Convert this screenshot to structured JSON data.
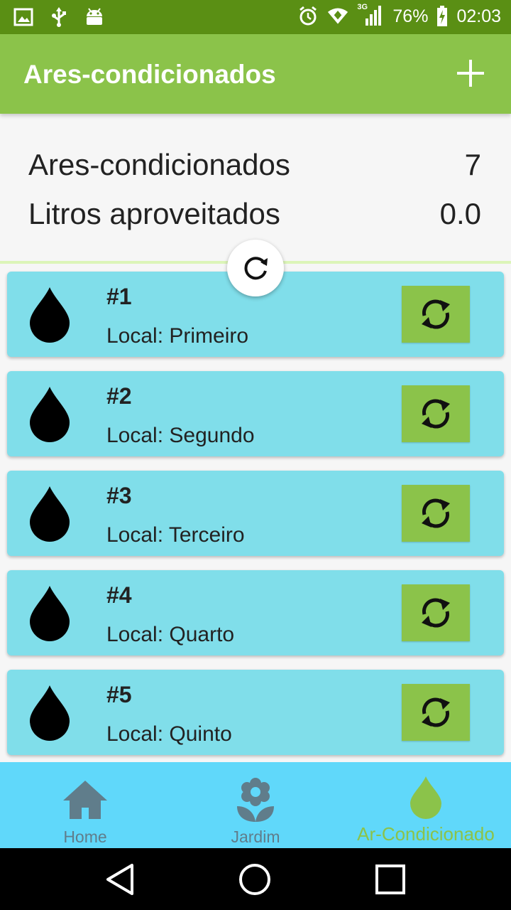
{
  "status_bar": {
    "left_icons": [
      "image-icon",
      "usb-icon",
      "android-icon"
    ],
    "network_label": "3G",
    "battery_percent": "76%",
    "time": "02:03"
  },
  "app_bar": {
    "title": "Ares-condicionados",
    "add_icon": "plus-icon"
  },
  "summary": {
    "count_label": "Ares-condicionados",
    "count_value": "7",
    "liters_label": "Litros aproveitados",
    "liters_value": "0.0"
  },
  "cards": [
    {
      "number": "#1",
      "location": "Local: Primeiro"
    },
    {
      "number": "#2",
      "location": "Local: Segundo"
    },
    {
      "number": "#3",
      "location": "Local: Terceiro"
    },
    {
      "number": "#4",
      "location": "Local: Quarto"
    },
    {
      "number": "#5",
      "location": "Local: Quinto"
    }
  ],
  "bottom_nav": {
    "items": [
      {
        "label": "Home",
        "icon": "home-icon",
        "active": false
      },
      {
        "label": "Jardim",
        "icon": "flower-icon",
        "active": false
      },
      {
        "label": "Ar-Condicionado",
        "icon": "drop-icon",
        "active": true
      }
    ]
  },
  "colors": {
    "status_bar": "#5a8f14",
    "app_bar": "#8bc34a",
    "card": "#80deea",
    "card_button": "#8bc34a",
    "bottom_nav": "#60d8fa",
    "nav_inactive": "#607d8b",
    "nav_active": "#8bc34a"
  }
}
